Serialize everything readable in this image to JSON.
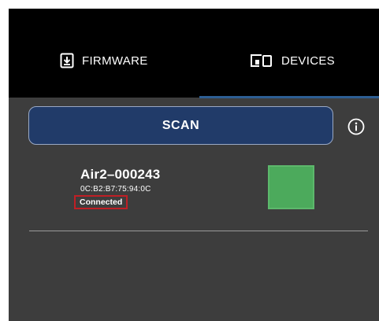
{
  "tabs": {
    "firmware": {
      "label": "FIRMWARE",
      "icon": "download-box-icon"
    },
    "devices": {
      "label": "DEVICES",
      "icon": "devices-icon",
      "selected": true
    }
  },
  "scan": {
    "label": "SCAN"
  },
  "info": {
    "icon": "info-icon"
  },
  "devices": [
    {
      "name": "Air2–000243",
      "mac": "0C:B2:B7:75:94:0C",
      "status": "Connected",
      "color": "#4caa5c"
    }
  ],
  "colors": {
    "tab_bar": "#000000",
    "background": "#3d3d3d",
    "accent": "#2d5e93",
    "scan_button": "#213b69",
    "status_highlight": "#c01f25"
  }
}
